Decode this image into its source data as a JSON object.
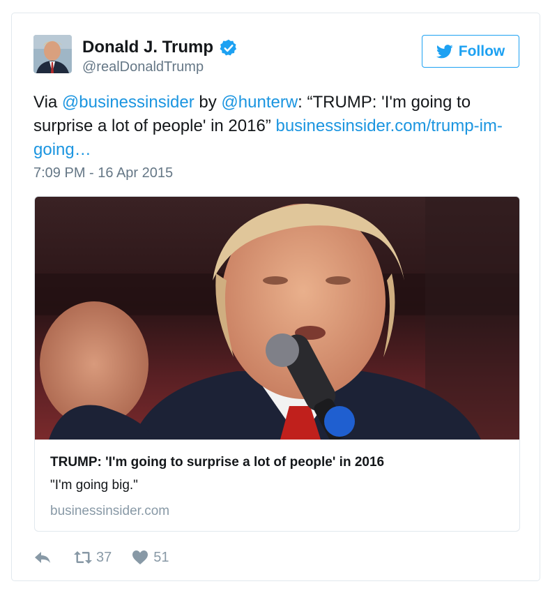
{
  "author": {
    "display_name": "Donald J. Trump",
    "handle": "@realDonaldTrump",
    "verified": true,
    "avatar_icon": "profile-photo"
  },
  "follow_button": {
    "label": "Follow",
    "icon": "twitter-bird-icon"
  },
  "tweet": {
    "text_parts": [
      {
        "type": "text",
        "value": "Via "
      },
      {
        "type": "link",
        "value": "@businessinsider"
      },
      {
        "type": "text",
        "value": " by "
      },
      {
        "type": "link",
        "value": "@hunterw"
      },
      {
        "type": "text",
        "value": ": “TRUMP: 'I'm going to surprise a lot of people' in 2016” "
      },
      {
        "type": "link",
        "value": "businessinsider.com/trump-im-going…"
      }
    ],
    "timestamp": "7:09 PM - 16 Apr 2015"
  },
  "card": {
    "image": "photo of Donald Trump speaking into a microphone",
    "title": "TRUMP: 'I'm going to surprise a lot of people' in 2016",
    "description": "\"I'm going big.\"",
    "domain": "businessinsider.com"
  },
  "actions": {
    "reply_icon": "reply-icon",
    "retweet_icon": "retweet-icon",
    "retweet_count": "37",
    "like_icon": "heart-icon",
    "like_count": "51"
  },
  "colors": {
    "link": "#1b95e0",
    "twitter_blue": "#1da1f2",
    "muted_text": "#657786",
    "icon_gray": "#8899a6",
    "border": "#e1e8ed"
  }
}
